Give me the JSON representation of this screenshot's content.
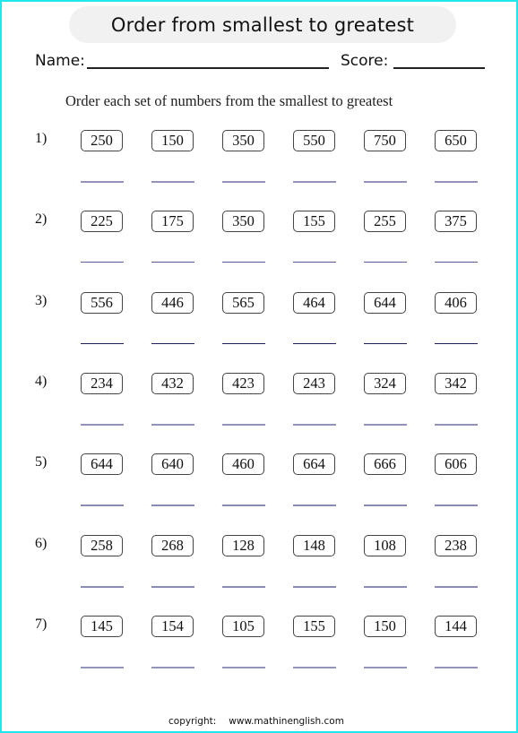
{
  "title": "Order from smallest to greatest",
  "header": {
    "name_label": "Name:",
    "score_label": "Score:"
  },
  "instruction": "Order each set of numbers from the smallest to greatest",
  "problems": [
    {
      "label": "1)",
      "numbers": [
        "250",
        "150",
        "350",
        "550",
        "750",
        "650"
      ],
      "line_color": "#9393b9"
    },
    {
      "label": "2)",
      "numbers": [
        "225",
        "175",
        "350",
        "155",
        "255",
        "375"
      ],
      "line_color": "#5b5b94"
    },
    {
      "label": "3)",
      "numbers": [
        "556",
        "446",
        "565",
        "464",
        "644",
        "406"
      ],
      "line_color": "#1f1f5e"
    },
    {
      "label": "4)",
      "numbers": [
        "234",
        "432",
        "423",
        "243",
        "324",
        "342"
      ],
      "line_color": "#9393b9"
    },
    {
      "label": "5)",
      "numbers": [
        "644",
        "640",
        "460",
        "664",
        "666",
        "606"
      ],
      "line_color": "#8a8ab3"
    },
    {
      "label": "6)",
      "numbers": [
        "258",
        "268",
        "128",
        "148",
        "108",
        "238"
      ],
      "line_color": "#8a8ab3"
    },
    {
      "label": "7)",
      "numbers": [
        "145",
        "154",
        "105",
        "155",
        "150",
        "144"
      ],
      "line_color": "#9393b9"
    }
  ],
  "footer": {
    "copyright_label": "copyright:",
    "url": "www.mathinenglish.com"
  },
  "colors": {
    "page_border": "#1ee8ee",
    "title_background": "#f1f1f1"
  }
}
